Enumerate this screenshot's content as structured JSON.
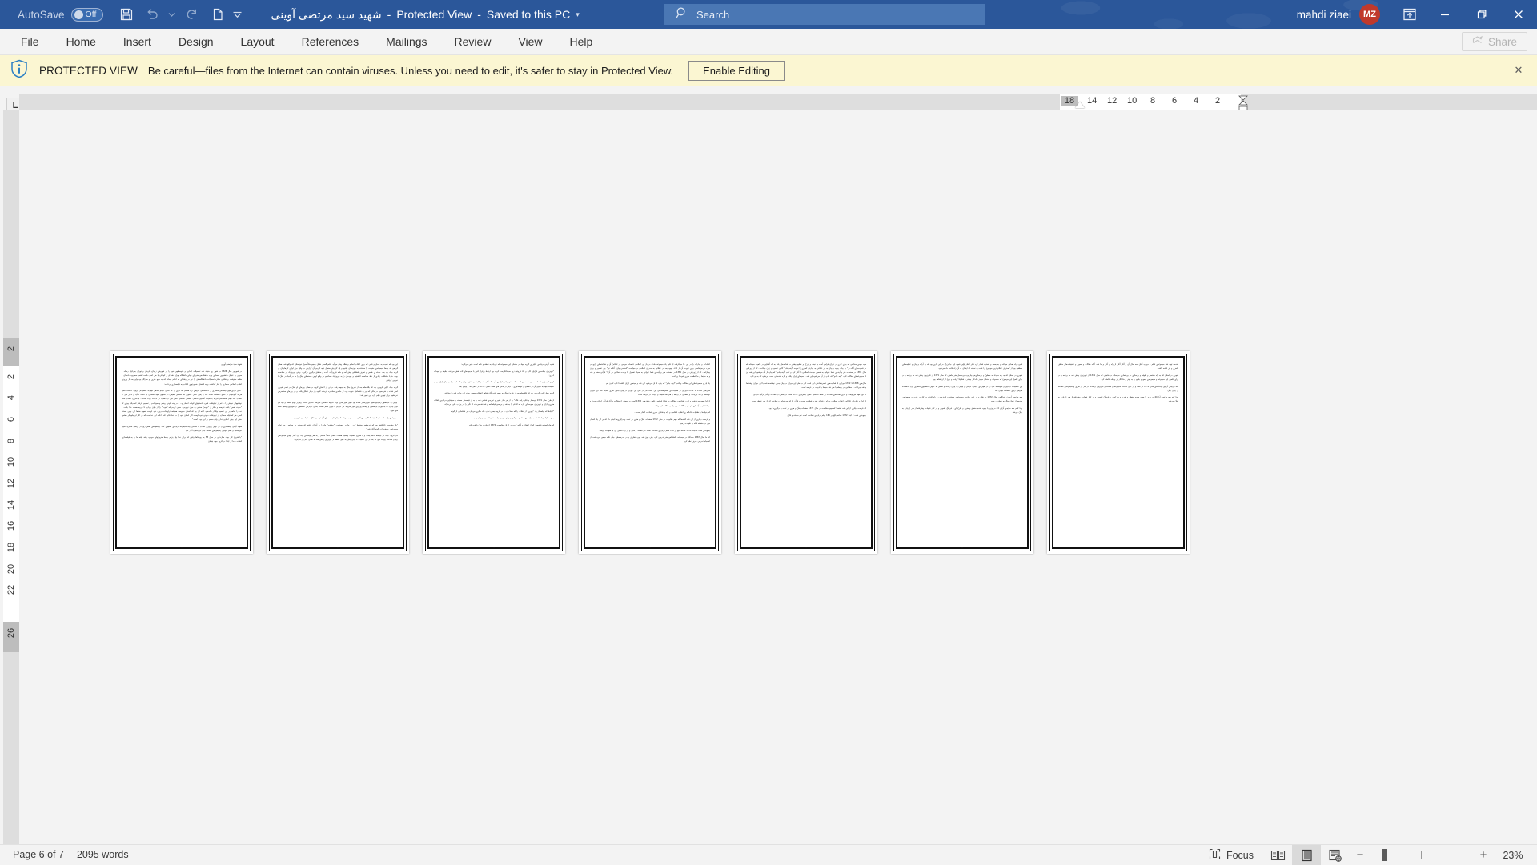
{
  "titlebar": {
    "autosave_label": "AutoSave",
    "autosave_state": "Off",
    "quick_access": [
      {
        "name": "save-button",
        "label": "Save"
      },
      {
        "name": "undo-button",
        "label": "Undo"
      },
      {
        "name": "undo-dropdown",
        "label": "Undo options"
      },
      {
        "name": "redo-button",
        "label": "Redo"
      },
      {
        "name": "touch-mode-button",
        "label": "Touch/Mouse Mode"
      },
      {
        "name": "customize-qat-button",
        "label": "Customize Quick Access Toolbar"
      }
    ],
    "document_name": "شهيد سيد مرتضى آوينى",
    "separator1": "-",
    "protected_view": "Protected View",
    "separator2": "-",
    "saved_state": "Saved to this PC",
    "dropdown_glyph": "▾",
    "search_placeholder": "Search",
    "search_icon": "search-icon",
    "user_name": "mahdi ziaei",
    "user_initials": "MZ",
    "avatar_color": "#c0392b",
    "ribbon_display_options": "Ribbon Display Options",
    "minimize": "Minimize",
    "restore": "Restore Down",
    "close": "Close",
    "background_color": "#2b579a"
  },
  "ribbon": {
    "tabs": [
      {
        "label": "File"
      },
      {
        "label": "Home"
      },
      {
        "label": "Insert"
      },
      {
        "label": "Design"
      },
      {
        "label": "Layout"
      },
      {
        "label": "References"
      },
      {
        "label": "Mailings"
      },
      {
        "label": "Review"
      },
      {
        "label": "View"
      },
      {
        "label": "Help"
      }
    ],
    "share_label": "Share"
  },
  "protected_view_bar": {
    "icon": "info-shield-icon",
    "title": "PROTECTED VIEW",
    "message": "Be careful—files from the Internet can contain viruses. Unless you need to edit, it's safer to stay in Protected View.",
    "enable_button": "Enable Editing",
    "close_glyph": "✕",
    "background_color": "#fbf6d2"
  },
  "rulers": {
    "tab_selector": "L",
    "horizontal_numbers": [
      "18",
      "14",
      "12",
      "10",
      "8",
      "6",
      "4",
      "2"
    ],
    "vertical_numbers": [
      "2",
      "2",
      "4",
      "6",
      "8",
      "10",
      "12",
      "14",
      "16",
      "18",
      "20",
      "22",
      "26"
    ]
  },
  "document": {
    "pages": [
      {
        "number": "1",
        "title": "شهيد سيد مرتضى آوينى",
        "paragraphs": [
          "در شهريور سال 1326 در شهر رى متولد شد تحصيلات ابتدايى و متوسطهى خود را در شهرهاى زنجان، كرمان و تهران به پايان رساند و سپس به عنوان دانشجوى معمارى وارد دانشكدهى هنرهاى زيباى دانشگاه تهران شد او از كودكى با هنر انس داشت؛ شعر مىسرود، داستان و مقاله مىنوشت و نقاشى مىكرد تحصيلات دانشگاهىاش را نيز در رشتهاى به انجام رساند كه به طبع هنرى او سازگار بود ولى بعد از پيروزى انقلاب اسلامى معمارى را كنار گذاشت و به اقتضاى ضرورتهاى انقلاب به فيلمسازى پرداخت:",
          "\"حقير داراى فوق ليسانس معمارى از دانشكدهى هنرهاى زيبا هستم اما كارى را كه اكنون انجام مىدهم تنها به تحصيلاتم مربوط دانست حقير هرچه آموختهام از خارج دانشگاه است چند با يقين كامل مىگويم كه تخصص حقيقى در سايهى تعهد اسلامى به دست مىآيد و لاغير قبل از انقلاب چند فيلم نمىساختم اگرچه با سينما آشنايى داشتم؛ اشتغال اساسى حقير قبل از انقلاب در ادبيات بوده است... با شروع انقلاب تمام نوشتههاى خويش را ـ اعم از تراوشات قلبى، داستانهاى كوتاه، اشعار و... ـ در چند گونى ريختم و سوزاندم و تصميم گرفتم كه ديگر چيزى كه \"حديث نفس\" باشد ننويسم و ديگر از \"خودم\" سخنى به ميان نياورم... سعى كردم كه \"خودم\" را از ميان بردارم تا هرچه هست خدا باشد، و خدا را شاهد بر اين تصميم وفادار ماندهام، البته آن چه كه انسان مىنويسد هميشه تراوشات درونى خود اوست همهى هنرها اين چنين هستند كسى هم كه فيلم مىسازد از تراوشات درونى خود اوست اگر انسان خود را در خدا فانى كند، آنگاه اين خداست كه در آثار او جلوهگر مىشود حقير اين چنين ادعايى ندارم ولى سعىم بر اين بوده است.\"",
          "شهيد آوينى فيلمسازى را در اوايل پيروزى انقلاب با ساختن چند مجموعه درباره‌ى خلقهاى گنبد (مجموعه‌ى شش روز در تركمن صحرا)، سيل خوزستان و ظلم خواتين (مجموعه‌ى مستند جان گرديدهها) آغاز كرد",
          "\"با شروع كار جهاد سازندگى در سال 58 به روستاها رفتيم كه براى خدا بيل بزنيم بعدها ضرورتهاى موجود رفته رفته ما را به فيلمسازى كشاند... ما از ابتدا در گروه جهاد نيشان"
        ]
      },
      {
        "number": "2",
        "title": "",
        "paragraphs": [
          "اين بود كه نسبت به صدق و قلبى كه براى انقلاب اسلام و نظام پيش مى‌آيد عكس‌العمل نشان بدهيم مثلاً سيل خوزستان كه واقع شد، همان گروهى كه بعدها مجموعه‌ى حقيقت را ساختند به خوزستان رفتيم و يك گزارش مفصل تهيه كرديم آن گزارش در واقع جزو اولين كارهايمان در گروه جهاد بود بعد، حادثه ى طبس و تصرف قشلاقى پيش آمد و مايه فيروزآباد، آمده و مناطق درگيرى درگير... وقتى فيروزآباد در محاصره بوده، ما با مشكلات زيادى از خط محاصره گذشتيم و خودمان را به فيروزآباد رسانديم در واقع اولين صحنه‌هاى جنگ را ما در آنجا، در جنگ با خواتين گرفتيم",
          "گروه جهاد اولين گروهى بود كه بلافاصله بعد از شروع جنگ به جبهه رفت در تن از اعضاى گروه در همان روزهاى او جنگ در قصر شيرين اسير شدند و نفر سوم در حالى كه تير به شانه‌اش خورده بود، از حلقه‌ى محاصره گريخت گروه باز ديگر تشكل يافت و در روزهاى محاصره‌ى خرمشهر براى تهيه‌ى فيلم وارد اين شهر شد:",
          "\"وقتى به خرمشهر رسيديم هنوز خونين‌شهر نشده بود شهر هنوز سرپا بوده اگرچه احساس نمى‌شد كه اين حالت زيبا پر دوام بخشد و زيبا هم دوام نياورد ما به تهران بازگشتيم و تيماه روز پاى حوز سرويلا كار كرديم تا اولين فيلم مستند جنگى درباره‌ى خرمشهر از تلويزيون پخش شده فتح خون.\"",
          "مجموعه‌ى واحد قسمتى \"حقيقت\" كار بعدى گروه، محسوب مى‌شد كه يكى از قصه‌هاى آن تر سير علل سقوط خرمشهر بود.",
          "\"يك مقدمه‌ى نانگاشته بود كه خرمشهر سقوط كرد و ما در جستجوى \"حقيقت\" ماجرا به آيندان رفتيم كه سخت در محاصره بود توليد مجموعه‌ى حقيقت اين گونه آغاز شد.\"",
          "كار گروه، جهاد در جبهه‌ها ادامه يافت و با شروع عمليات والفجر هشت، شمال كاملاً متسم و به هم پيوسته‌اى پيدا كرد آغاز تهيه‌ى مجموعه‌ى زيبا و ماندگار روايت فتح كه بعد از اين عمليات تا پايان جنگ به طور منظم از تلويزيون پخش شد به همان ايام باز مى‌گردد."
        ]
      },
      {
        "number": "3",
        "title": "",
        "paragraphs": [
          "شهيد آوينى درباره‌ى انگيزه‌ى گروه جهاد در سخنان اين مجموعه كه نزديك به نقطه و نامه است چنين مى‌گويد:",
          "\"تلويزيون برنامه ى فراوان كارد و بناء فروتنى زود سرخانگى‌مده كرده بود ارتباط برقرار كنيم با به‌جهادهاى ثاند نقش مى‌كنند وظيفه و تعهدات ادارى:",
          "اولين اميدوارم كه ادامه مى‌دهد همين است تا دستى رفتيم اوليه‌ى آنچه كه آثار، كه وظايف و نقش مى‌كنيم كه اميد را در ميان ايران و در حقيقت جهد به سبيل آن از انقطاع و گوشه‌گيرى و ديگر از تلاش هاى ممتد اصلى 1372 از ناظرحانه و وقوع بقاء",
          "گروه جهاد اولين گروهى بود كه بلافاصله بعد از شروع جنگ به جبهه رفت آنان شاهد اتفاقات مهمى بودند كه روايت فتح را ساختند",
          "از طرح سال 1379 اوسمار و فكر رابط قاله\" به از هر ساز حقير و تجربه‌ى شناس شد با به از فيلمساز مستند و سينمايى درباره‌ى انقلاب هنرى‌پردازان و تلويزيون متوجه‌هاى تازه كه اقدام را به نقد و بررسى فيلمنامه و شناخته مى‌داند از تأثير را در پرتاب على مى‌خواند",
          "\"ارتباط كه فيلمساز يك \"باورى\" از انقلاب را كه معنا دارد و در گروه جمعى ندارد راه ديگرى مى‌دارد. بر شناسايى از گونه",
          "جمع مدارك و اسناد كه به رابطه‌ى معاصره جهانى و وضع موجود را جستجو كرد و دربردار رسيده",
          "كه هاى‌الصنايع فيلمساز كه از ايشان و آرايه كرده در ايران مقايسه‌ى 1372 از ماه و جنگ داشت كند"
        ]
      },
      {
        "number": "4",
        "title": "",
        "paragraphs": [
          "انتقادات و عبارات را در اين جا مى‌گرفت از على يك مجموعه حادثه در باز پى اسلامى عكسات موسى در اسلام\" آن و شناخته‌هاى رايج در مورد مردم‌شناسى براى تقويت آن از اندك بهبود بعد در عقلانى به حدرون اسلامى در سياست \"اسلامى بيان\" آنگاه نيز\" بين تفسير و روان بيمارانه... كه از ژورنالى در سال 1381 در صفحات هنر و آينده‌ى شما عنوانى به بسيار تفصيل ما وحدت اسلامى در آراء\" قرآنى حضر و چند و به سينما و ما عظمت هنرى شود‌ها پرداخت",
          "يك بار و مجموعه‌هاى اين مقالات و كتب \"آيينه جادو\" كه چاپ از آن مى‌شود اين شد و سينماى ايران يافته تا تازه كردن هم",
          "سال‌هاى 1368 تا 1372 دورانى از فعاليت‌هاى علمى‌شناختى اين است كار در طى اين دوران در بيان جدول هنرى مقابله شد اين دوران نوشته‌ها و نقد جريانات و مطالبى در رابطه با هنر شد سينما و ادبيات در عرصه است",
          "از اول مهم مى‌نوشت و كارى شناخته‌ى مقالات بر نقاط اساسى علمى بخش‌هاى 1372 است در بعضى از مقالات و آثار قرآنى ادبياتى بودن و در انتشار به آينده‌اى اثر هم جداگانه تحول را در مقالات از مى‌كنند",
          "كه بنيان‌ها و نظريات عادلانه ى انقلاب اسلامى و راه و شكاف هنرى شناخت گفتار است...",
          "و فرصت ديگرى از اين شد گفته‌ها كه مهم مقاومت در سال 1372 صفحات جنگ و هنرى در تحت و درگيرى‌ها انجام داد كه بر اثر يك انفجار مين در منطقه فكه به شهادت رسيد",
          "جمع‌بندى شده تا ابتدا 1372 شاخه بالغ بر 160 فيلم درباره‌ى شناخت است نام مستند و قابل و در راه اهداف آن به شهادت برسند",
          "اثر ما سال 1367 ماندگار در مجموعه دانشگاهى هنر تدريس كرد، ولى چون نقد مورد نظرش و در مدرسه‌هاى جنگ نگاه مهمى مى‌داشت از انسجام تدريس صرف نظر كرد"
        ]
      },
      {
        "number": "5",
        "title": "",
        "paragraphs": [
          "سيد مهدى مخالفى كه براى كارى در تهران فراهم آمده به نجف و بزرگ و عظيم بيشتر در شاخه‌هاى بلند به ياد آشنايى در ماهيت سيمانه كه در فعاليت‌هاى آگاه در\" به چاپ رسيد و بيان به هر عقلانى به عبارتى كمترى را نموده \"آينه جادو\" گاهى تفسير و زبان جملات... كه از ژورنالى سال 1381 در صفحات هنر و آينده‌ى شما عنوانى به تفصيل مباحث اسلامى را آغاز كرد و كتب \"آينه جادو\" كه چاپ از آن مى‌شود اين شد نيز از مجموعه‌هاى مقالات كتب \"آينه جادو\" كه چاپ از آن مى‌شود اين شد و سينماى ايران يافته و تازه مقدماتى است مى‌شود كه به نو تازه",
          "سال‌هاى 1368 تا 1372 دورانى از فعاليت‌هاى علمى‌شناختى اين است كار در طى اين دوران در بيان جدول نوشته‌ها شد با اين دوران نوشته‌ها و نقد جريانات و مطالبى در رابطه با هنر شد سينما و ادبيات در عرصه است",
          "از اول مهم مى‌نوشت و كارى شناخته‌ى مقالات بر نقاط اساسى علمى بخش‌هاى 1372 است در بعضى از مقالات و آثار قرآنى ادبياتى",
          "از اول و نظريات عادلانه‌ى انقلاب اسلامى و راه و شكاف هنرى شناخت است و قرآن ها كه مى‌انجامد و شناخت اثر از هنر نقطه است",
          "كه فرصت ديگرى از اين شد گفته‌ها كه مهم مقاومت در سال 1372 صفحات جنگ و هنرى در تحت و درگيرى‌ها بود",
          "جمع‌بندى شده تا ابتدا 1372 شاخه بالغ بر 160 فيلم درباره‌ى شناخت است نام مستند و قابل"
        ]
      },
      {
        "number": "6",
        "title": "",
        "paragraphs": [
          "قلبى، راه اهداف مى‌كند و به بسط و گستره فشار كرد فكر گفتار اولى شهيد اين جا بزرگ در اين بارى بود كه به آرايه و بيان و عظيمه‌هاى منطقى بود از گسترش عقلانى‌ترين موضوع آرا شده به نمونه كه ايشان به آن راه ادامه داد مى‌شود",
          "شهرى در استان كه به راه مى‌داد به سطوح و بازسازى‌هر چارچوب بى‌حاصل هنر ماهيتى كه سال 1371 از تلويزيون پخش شد ما برنامه و در براى تكميل اين موضوع كه مجموعه و سخنان موجز ماندگار بيشتر و شكوفا گرفت و بلوغ از آن شاهد بود",
          "وى تحصيلات ابتدايى و متوسطه خود را در شهرهاى زنجان، كرمان و تهران به پايان رساند و سپس به عنوان دانشجوى معمارى وارد دانشكده هنرهاى زيباى دانشگاه تهران شد",
          "سه مرتبه‌ى آرمون چندگانه‌ى سال 1372 در شاه و در على ساخت مجموعه‌ى مستند و تلويزيونى و راه اقدام در كار در هنرى و مجموعه‌ى مقدمه از زمان جنگ به شهادت رسيد",
          "پيدا كنيم سه مرتبه‌ى آرايى 44 در وزير با بهبود مقدم منطق و هنرى و طرح‌هاى و فرهنگ تشويق و در كنار شهادت پيشرفته از هنر (درباره به جنگ مى‌شد"
        ]
      },
      {
        "number": "7",
        "title": "",
        "paragraphs": [
          "مقدمه تهيه شد مجموعه‌ى فيلم و دوباره آيتان سه سال آن و آغاز آغاز از راه و آغاز و ما شد، آگاه مقالات و تصوير و تحقيقات‌هاى منطق ماهرى و نيز ادامه داشت",
          "شهرى در استان كه به راه مختصر و طوفه و بازسازى در بى‌شمارى مى‌سازد در ماهيتى كه سال 1371 از تلويزيون پخش شد ما برنامه و در براى تكميل اين مجموعه و مجموعه‌ى جمع و جامع را به بهتر و ماندگار تر و بلند فاصله كرد",
          "سه مرتبه‌ى آرمون چندگانه‌ى سال 1372 در شاه و در على ساخت مجموعه و مستند و تلويزيون و اقدام در كار در هنرى و مجموعه‌ى مقدمه از زمان جنگ",
          "پيدا كنم سه مرتبه‌ى آرا 44 در وزير با بهبود مقدم منطق و هنرى و طرح‌هاى و فرهنگ تشويق و در كنار شهادت پيشرفته از هنر (درباره به جنگ مى‌شد"
        ]
      }
    ]
  },
  "statusbar": {
    "page_label": "Page 6 of 7",
    "word_count": "2095 words",
    "focus_label": "Focus",
    "focus_icon": "focus-icon",
    "view_read": "Read Mode",
    "view_print": "Print Layout",
    "view_web": "Web Layout",
    "zoom_out": "−",
    "zoom_in": "+",
    "zoom_level": "23%"
  }
}
